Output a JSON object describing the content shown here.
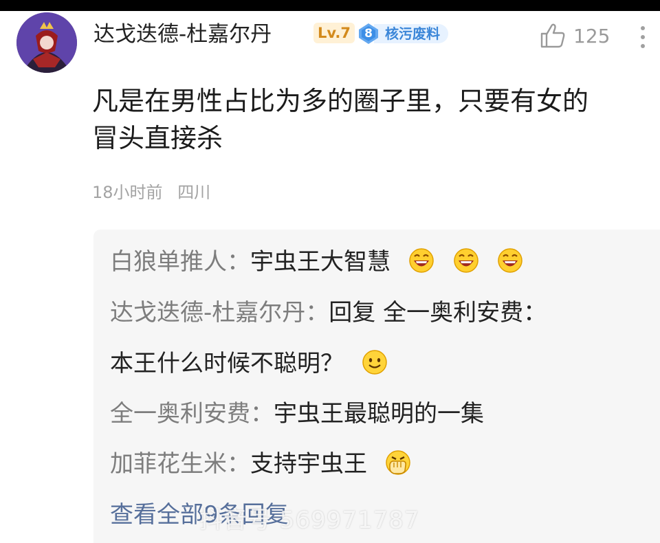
{
  "comment": {
    "username": "达戈迭德-杜嘉尔丹",
    "level": "Lv.7",
    "medal": {
      "number": "8",
      "title": "核污废料"
    },
    "likes": "125",
    "text_lines": [
      "凡是在男性占比为多的圈子里，只要有女的",
      "冒头直接杀"
    ],
    "time": "18小时前",
    "location": "四川",
    "icons": {
      "avatar": "avatar",
      "like": "thumbs-up-icon",
      "more": "more-vertical-icon"
    }
  },
  "replies": [
    {
      "author": "白狼单推人：",
      "text": "宇虫王大智慧",
      "emojis": [
        "laughing-emoji-icon",
        "laughing-emoji-icon",
        "laughing-emoji-icon"
      ]
    },
    {
      "author": "达戈迭德-杜嘉尔丹：",
      "text": "回复 全一奥利安费：",
      "emojis": []
    },
    {
      "author": "",
      "text": "本王什么时候不聪明？",
      "emojis": [
        "smiling-emoji-icon"
      ]
    },
    {
      "author": "全一奥利安费：",
      "text": "宇虫王最聪明的一集",
      "emojis": []
    },
    {
      "author": "加菲花生米：",
      "text": "支持宇虫王",
      "emojis": [
        "fist-emoji-icon"
      ]
    }
  ],
  "view_all": "查看全部9条回复",
  "watermark": "抖音号 569971787",
  "colors": {
    "background": "#ffffff",
    "reply_bg": "#f6f6f6",
    "link": "#566f9b",
    "level_text": "#d38a1c",
    "medal_blue": "#3b86d8"
  }
}
